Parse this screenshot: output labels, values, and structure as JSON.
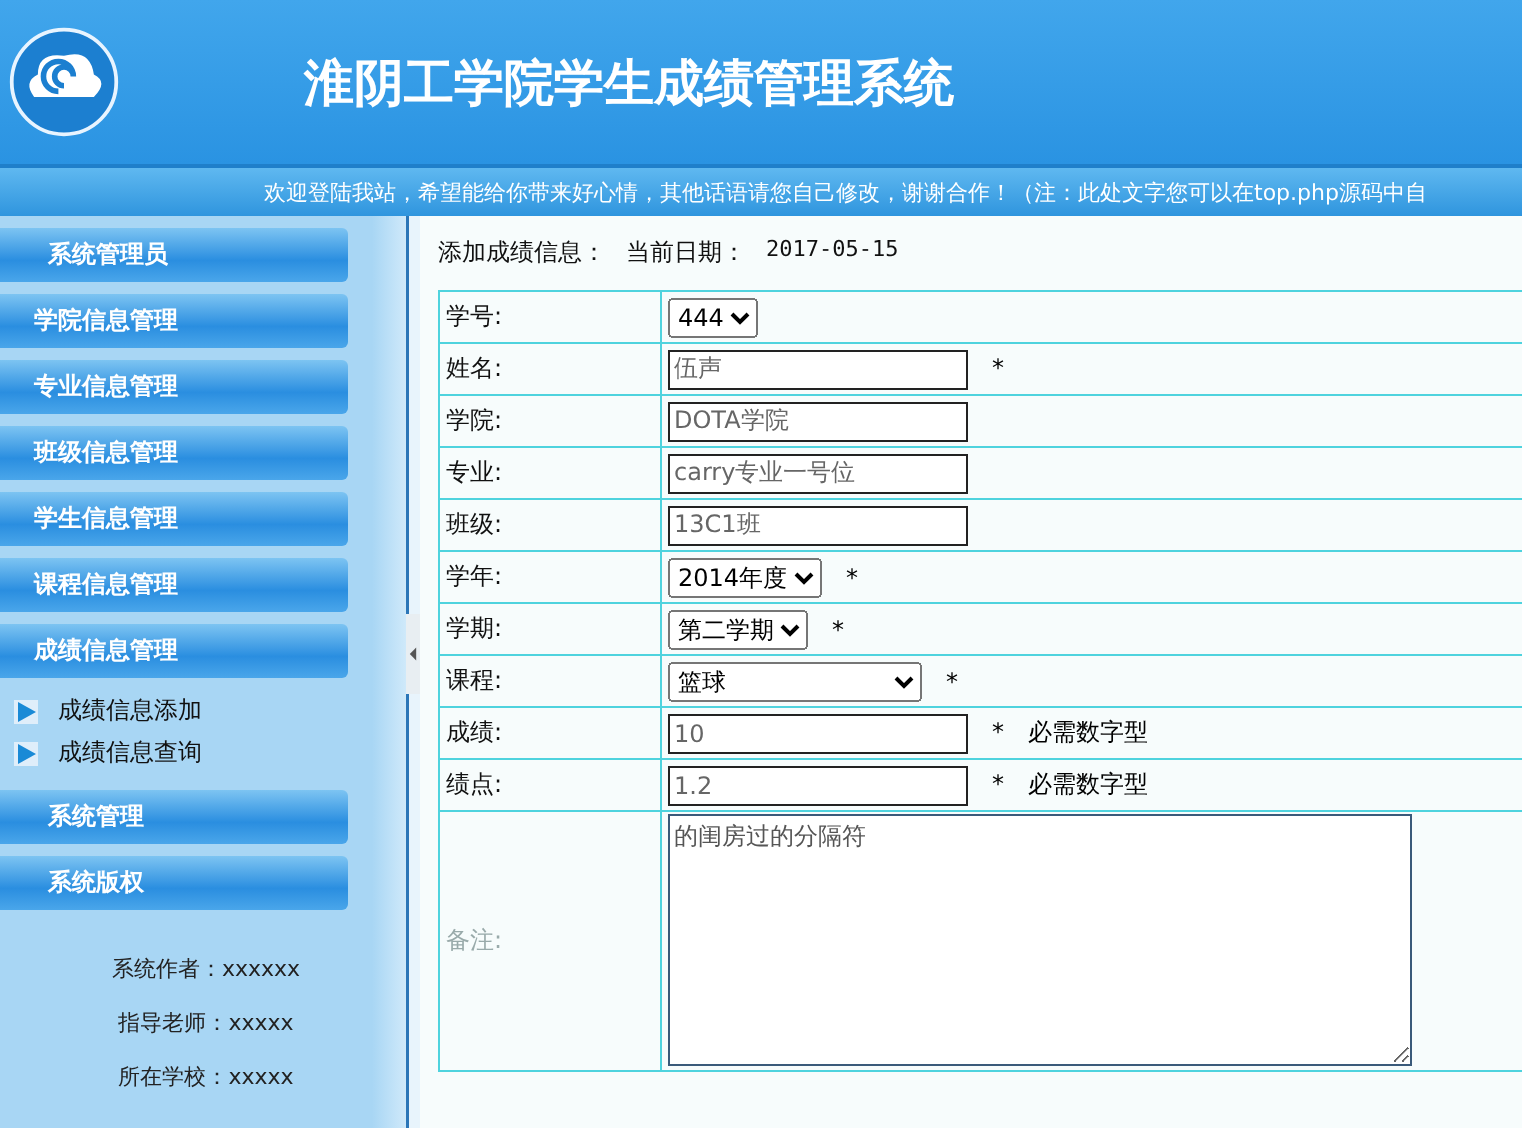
{
  "header": {
    "title": "淮阴工学院学生成绩管理系统"
  },
  "marquee": "欢迎登陆我站，希望能给你带来好心情，其他话语请您自己修改，谢谢合作！（注：此处文字您可以在top.php源码中自",
  "sidebar": {
    "menus": [
      {
        "label": "系统管理员",
        "kind": "title"
      },
      {
        "label": "学院信息管理",
        "kind": "menu"
      },
      {
        "label": "专业信息管理",
        "kind": "menu"
      },
      {
        "label": "班级信息管理",
        "kind": "menu"
      },
      {
        "label": "学生信息管理",
        "kind": "menu"
      },
      {
        "label": "课程信息管理",
        "kind": "menu"
      },
      {
        "label": "成绩信息管理",
        "kind": "menu",
        "children": [
          {
            "label": "成绩信息添加"
          },
          {
            "label": "成绩信息查询"
          }
        ]
      },
      {
        "label": "系统管理",
        "kind": "title"
      },
      {
        "label": "系统版权",
        "kind": "title"
      }
    ],
    "info": [
      "系统作者：xxxxxx",
      "指导老师：xxxxx",
      "所在学校：xxxxx"
    ]
  },
  "main": {
    "heading": "添加成绩信息：",
    "date_label": "当前日期：",
    "date": "2017-05-15",
    "rows": [
      {
        "label": "学号:",
        "kind": "select",
        "value": "444"
      },
      {
        "label": "姓名:",
        "kind": "input",
        "value": "伍声",
        "mark": "*"
      },
      {
        "label": "学院:",
        "kind": "input",
        "value": "DOTA学院"
      },
      {
        "label": "专业:",
        "kind": "input",
        "value": "carry专业一号位"
      },
      {
        "label": "班级:",
        "kind": "input",
        "value": "13C1班"
      },
      {
        "label": "学年:",
        "kind": "select",
        "value": "2014年度",
        "mark": "*"
      },
      {
        "label": "学期:",
        "kind": "select",
        "value": "第二学期",
        "mark": "*"
      },
      {
        "label": "课程:",
        "kind": "select-wide",
        "value": "篮球",
        "mark": "*"
      },
      {
        "label": "成绩:",
        "kind": "input",
        "value": "10",
        "mark": "*",
        "hint": "必需数字型"
      },
      {
        "label": "绩点:",
        "kind": "input",
        "value": "1.2",
        "mark": "*",
        "hint": "必需数字型"
      },
      {
        "label": "备注:",
        "kind": "textarea",
        "value": "的闺房过的分隔符"
      }
    ]
  }
}
